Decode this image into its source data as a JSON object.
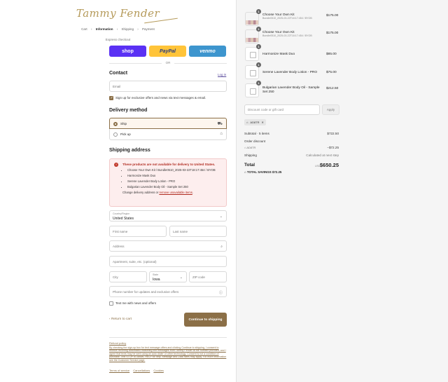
{
  "brand": {
    "logo_text": "Tammy Fender"
  },
  "breadcrumbs": [
    "Cart",
    "Information",
    "Shipping",
    "Payment"
  ],
  "breadcrumb_separator": "›",
  "express": {
    "label": "Express checkout",
    "shop_label": "shop",
    "paypal_label": "PayPal",
    "venmo_label": "venmo",
    "or_label": "OR"
  },
  "contact": {
    "title": "Contact",
    "login_label": "Log in",
    "email_placeholder": "Email",
    "signup_label": "Sign up for exclusive offers and news via text messages & email.",
    "signup_checked": true
  },
  "delivery": {
    "title": "Delivery method",
    "ship_label": "Ship",
    "pickup_label": "Pick up",
    "selected": "ship"
  },
  "shipping": {
    "title": "Shipping address",
    "warning_title": "These products are not available for delivery to United States.",
    "warning_items": [
      "Choose Your Own Kit / Bundle0510_2025-03-22T18:17:454 / BYOB",
      "Harmonize Mask Duo",
      "Serene Lavender Body Lotion - PRO",
      "Bulgarian Lavender Body Oil - Sample Set 250"
    ],
    "warning_foot_prefix": "Change delivery address or ",
    "warning_foot_link": "remove unavailable items",
    "warning_foot_suffix": ".",
    "country_label": "Country/Region",
    "country_value": "United States",
    "first_name_placeholder": "First name",
    "last_name_placeholder": "Last name",
    "address_placeholder": "Address",
    "apartment_placeholder": "Apartment, suite, etc. (optional)",
    "city_placeholder": "City",
    "state_label": "State",
    "state_value": "Iowa",
    "zip_placeholder": "ZIP code",
    "phone_placeholder": "Phone number for updates and exclusive offers",
    "text_me_label": "Text me with news and offers",
    "text_me_checked": false
  },
  "actions": {
    "back_label": "Return to cart",
    "continue_label": "Continue to shipping"
  },
  "footer": {
    "refund_label": "Refund policy",
    "consent_text": "By checking the sign-up box for text message offers and clicking Continue to shipping, I consent to receive recurring automated marketing text messages from Tammy Fender at the number provided, and I agree that texts may be sent using an auto dialer or other technology. Consent is not a condition of purchase. Text STOP to cancel, HELP for help. Message and Data rates may apply. For more information see the Customer Service page.",
    "links": [
      "Terms of service",
      "Cancellations",
      "Cookies"
    ]
  },
  "order": {
    "items": [
      {
        "qty": "1",
        "name": "Choose Your Own Kit",
        "sub": "Bundle0510_2025-03-22T18:17:454 / BYOB",
        "price": "$175.00",
        "thumb": "kit"
      },
      {
        "qty": "1",
        "name": "Choose Your Own Kit",
        "sub": "Bundle0510_2025-03-22T18:17:454 / BYOB",
        "price": "$175.00",
        "thumb": "kit"
      },
      {
        "qty": "1",
        "name": "Harmonize Mask Duo",
        "sub": "",
        "price": "$85.00",
        "thumb": "ph"
      },
      {
        "qty": "1",
        "name": "Serene Lavender Body Lotion - PRO",
        "sub": "",
        "price": "$75.00",
        "thumb": "ph"
      },
      {
        "qty": "1",
        "name": "Bulgarian Lavender Body Oil - Sample Set 250",
        "sub": "",
        "price": "$212.50",
        "thumb": "ph"
      }
    ],
    "discount_placeholder": "Discount code or gift card",
    "apply_label": "Apply",
    "applied_code": "AD8TR",
    "subtotal_label": "Subtotal · 5 items",
    "subtotal_value": "$722.50",
    "order_discount_label": "Order discount",
    "discount_code_label": "AD8TR",
    "discount_value": "−$72.25",
    "shipping_label": "Shipping",
    "shipping_value": "Calculated at next step",
    "total_label": "Total",
    "total_currency": "USD",
    "total_value": "$650.25",
    "savings_label": "TOTAL SAVINGS",
    "savings_value": "$72.25"
  }
}
